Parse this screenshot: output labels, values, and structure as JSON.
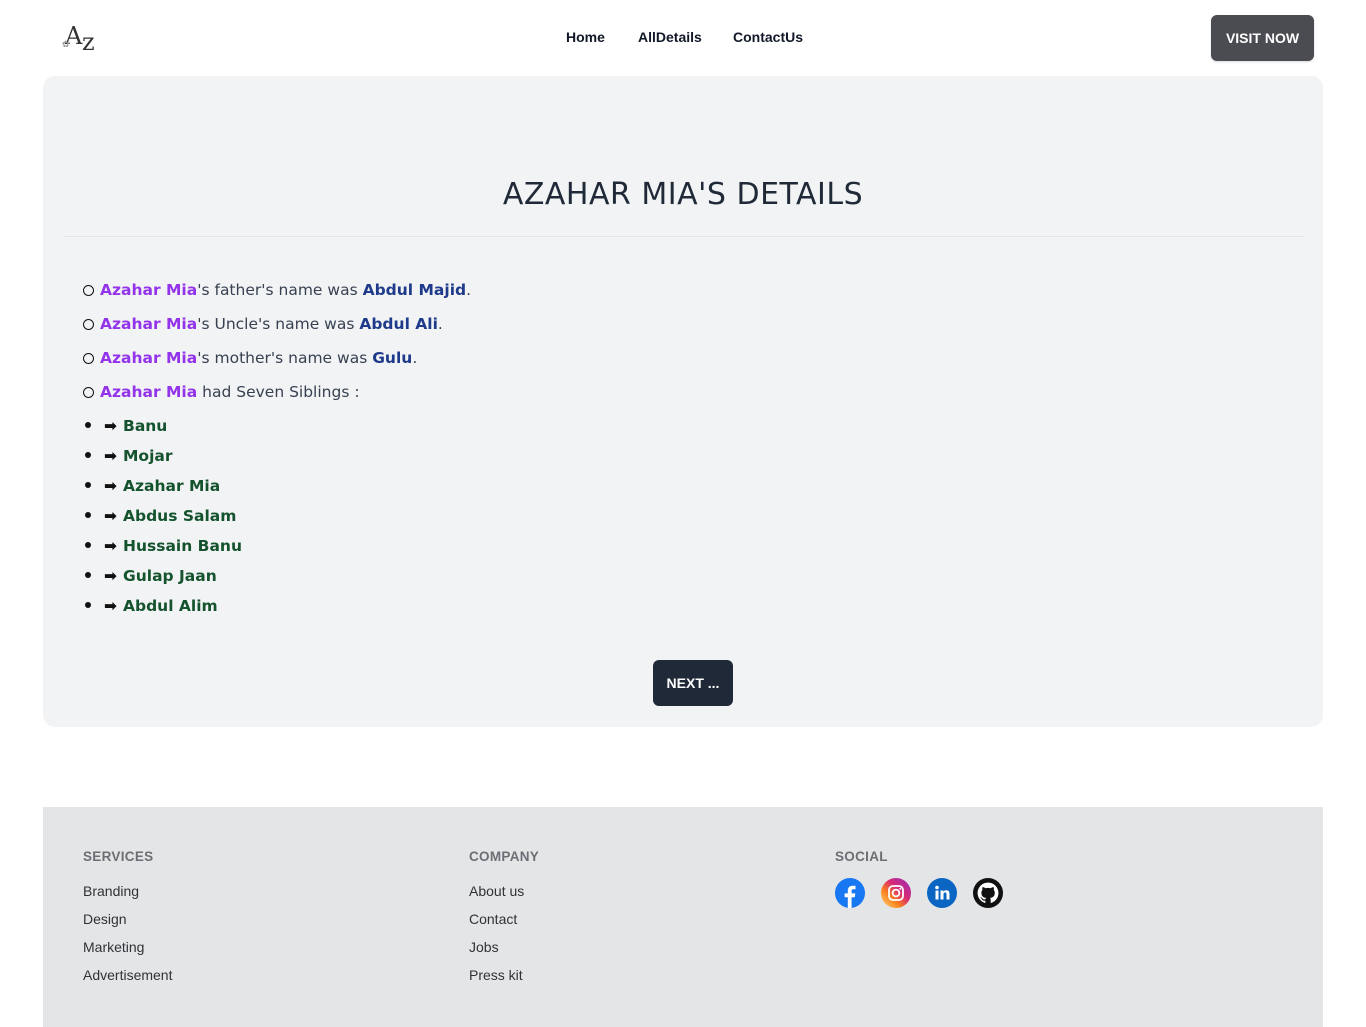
{
  "header": {
    "logo_text": "Az",
    "nav": [
      {
        "label": "Home"
      },
      {
        "label": "AllDetails"
      },
      {
        "label": "ContactUs"
      }
    ],
    "visit_label": "VISIT NOW"
  },
  "main": {
    "title": "AZAHAR MIA'S DETAILS",
    "facts": [
      {
        "subject": "Azahar Mia",
        "text": "'s father's name was ",
        "value": "Abdul Majid",
        "end": "."
      },
      {
        "subject": "Azahar Mia",
        "text": "'s Uncle's name was ",
        "value": "Abdul Ali",
        "end": "."
      },
      {
        "subject": "Azahar Mia",
        "text": "'s mother's name was ",
        "value": "Gulu",
        "end": "."
      },
      {
        "subject": "Azahar Mia",
        "text": " had Seven Siblings :",
        "value": "",
        "end": ""
      }
    ],
    "arrow": "➡",
    "siblings": [
      "Banu",
      "Mojar",
      "Azahar Mia",
      "Abdus Salam",
      "Hussain Banu",
      "Gulap Jaan",
      "Abdul Alim"
    ],
    "next_label": "NEXT ..."
  },
  "footer": {
    "services": {
      "heading": "SERVICES",
      "links": [
        "Branding",
        "Design",
        "Marketing",
        "Advertisement"
      ]
    },
    "company": {
      "heading": "COMPANY",
      "links": [
        "About us",
        "Contact",
        "Jobs",
        "Press kit"
      ]
    },
    "social": {
      "heading": "SOCIAL",
      "icons": [
        "facebook-icon",
        "instagram-icon",
        "linkedin-icon",
        "github-icon"
      ]
    }
  },
  "colors": {
    "accent_purple": "#9333ea",
    "accent_blue": "#1e3a8a",
    "accent_green": "#14532d",
    "dark_button": "#1f2937",
    "visit_button": "#4b4b52"
  }
}
